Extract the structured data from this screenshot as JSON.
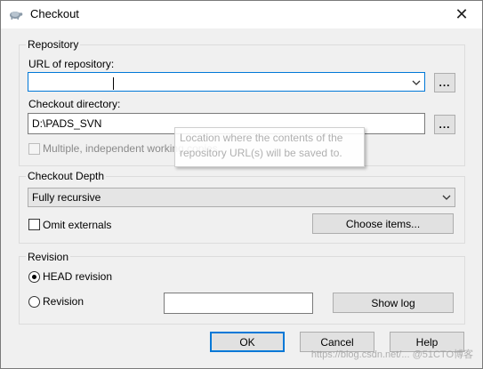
{
  "window": {
    "title": "Checkout",
    "close_glyph": "✕"
  },
  "repository": {
    "group_label": "Repository",
    "url_label": "URL of repository:",
    "url_value": "",
    "browse_label": "...",
    "dir_label": "Checkout directory:",
    "dir_value": "D:\\PADS_SVN",
    "dir_browse_label": "...",
    "multiple_label": "Multiple, independent working copies",
    "tooltip_line1": "Location where the contents of the",
    "tooltip_line2": "repository URL(s) will be saved to."
  },
  "depth": {
    "group_label": "Checkout Depth",
    "selected": "Fully recursive",
    "omit_label": "Omit externals",
    "choose_items_label": "Choose items..."
  },
  "revision": {
    "group_label": "Revision",
    "head_label": "HEAD revision",
    "rev_label": "Revision",
    "rev_value": "",
    "show_log_label": "Show log"
  },
  "buttons": {
    "ok": "OK",
    "cancel": "Cancel",
    "help": "Help"
  },
  "watermark": "https://blog.csdn.net/... @51CTO博客",
  "icons": {
    "title": "tortoise-icon",
    "dropdown": "chevron-down-icon"
  },
  "colors": {
    "focus_border": "#0078d7",
    "dialog_bg": "#f0f0f0"
  }
}
